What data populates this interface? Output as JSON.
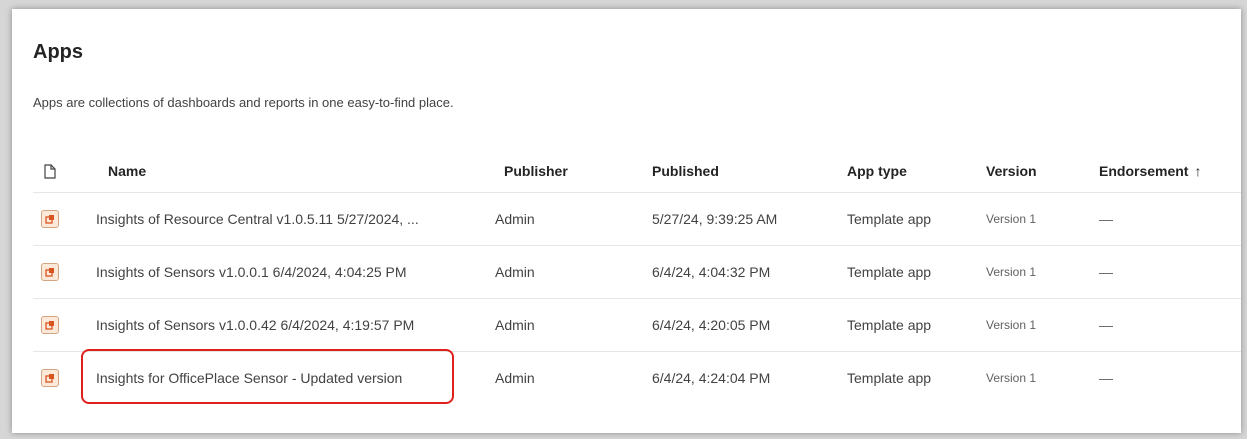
{
  "page": {
    "title": "Apps",
    "subtitle": "Apps are collections of dashboards and reports in one easy-to-find place."
  },
  "table": {
    "columns": {
      "icon": "document-icon",
      "name": "Name",
      "publisher": "Publisher",
      "published": "Published",
      "app_type": "App type",
      "version": "Version",
      "endorsement": "Endorsement",
      "endorsement_sort": "↑"
    },
    "rows": [
      {
        "icon": "app-icon",
        "name": "Insights of Resource Central v1.0.5.11 5/27/2024, ...",
        "publisher": "Admin",
        "published": "5/27/24, 9:39:25 AM",
        "app_type": "Template app",
        "version": "Version 1",
        "endorsement": "—"
      },
      {
        "icon": "app-icon",
        "name": "Insights of Sensors v1.0.0.1 6/4/2024, 4:04:25 PM",
        "publisher": "Admin",
        "published": "6/4/24, 4:04:32 PM",
        "app_type": "Template app",
        "version": "Version 1",
        "endorsement": "—"
      },
      {
        "icon": "app-icon",
        "name": "Insights of Sensors v1.0.0.42 6/4/2024, 4:19:57 PM",
        "publisher": "Admin",
        "published": "6/4/24, 4:20:05 PM",
        "app_type": "Template app",
        "version": "Version 1",
        "endorsement": "—"
      },
      {
        "icon": "app-icon",
        "name": "Insights for OfficePlace Sensor - Updated version",
        "publisher": "Admin",
        "published": "6/4/24, 4:24:04 PM",
        "app_type": "Template app",
        "version": "Version 1",
        "endorsement": "—"
      }
    ]
  },
  "colors": {
    "highlight": "#e0201b",
    "app_icon_fill": "#fde9d9",
    "app_icon_accent": "#d9541e"
  }
}
